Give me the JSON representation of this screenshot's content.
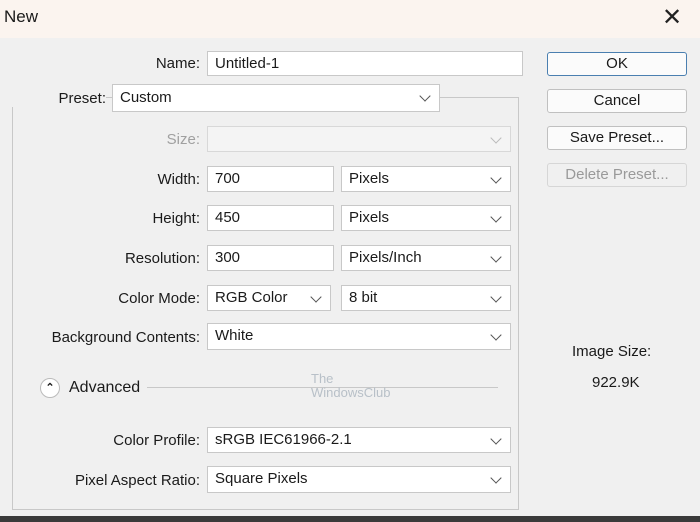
{
  "window": {
    "title": "New",
    "close_icon": "close-icon"
  },
  "form": {
    "name": {
      "label": "Name:",
      "value": "Untitled-1"
    },
    "preset": {
      "label": "Preset:",
      "value": "Custom"
    },
    "size": {
      "label": "Size:",
      "value": ""
    },
    "width": {
      "label": "Width:",
      "value": "700",
      "unit": "Pixels"
    },
    "height": {
      "label": "Height:",
      "value": "450",
      "unit": "Pixels"
    },
    "resolution": {
      "label": "Resolution:",
      "value": "300",
      "unit": "Pixels/Inch"
    },
    "color_mode": {
      "label": "Color Mode:",
      "value": "RGB Color",
      "depth": "8 bit"
    },
    "background": {
      "label": "Background Contents:",
      "value": "White"
    },
    "advanced": {
      "label": "Advanced"
    },
    "color_profile": {
      "label": "Color Profile:",
      "value": "sRGB IEC61966-2.1"
    },
    "pixel_aspect": {
      "label": "Pixel Aspect Ratio:",
      "value": "Square Pixels"
    }
  },
  "buttons": {
    "ok": "OK",
    "cancel": "Cancel",
    "save_preset": "Save Preset...",
    "delete_preset": "Delete Preset..."
  },
  "image_size": {
    "label": "Image Size:",
    "value": "922.9K"
  },
  "watermark": {
    "line1": "The",
    "line2": "WindowsClub"
  }
}
